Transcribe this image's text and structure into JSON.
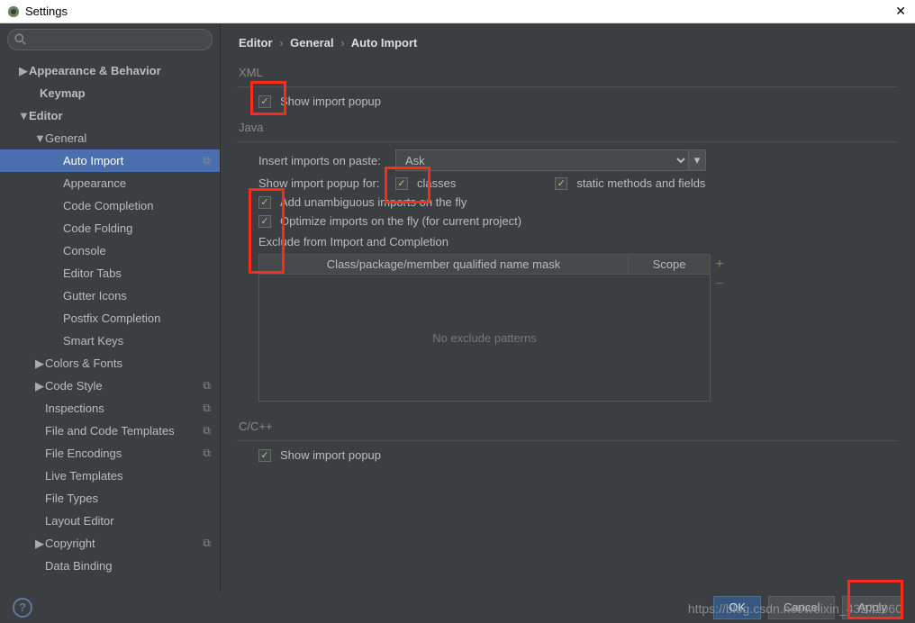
{
  "window": {
    "title": "Settings"
  },
  "search": {
    "placeholder": ""
  },
  "tree": [
    {
      "label": "Appearance & Behavior",
      "indent": 20,
      "arrow": "▶",
      "bold": true
    },
    {
      "label": "Keymap",
      "indent": 32,
      "arrow": "",
      "bold": true
    },
    {
      "label": "Editor",
      "indent": 20,
      "arrow": "▼",
      "bold": true
    },
    {
      "label": "General",
      "indent": 38,
      "arrow": "▼",
      "bold": false
    },
    {
      "label": "Auto Import",
      "indent": 58,
      "arrow": "",
      "bold": false,
      "selected": true,
      "copy": true
    },
    {
      "label": "Appearance",
      "indent": 58,
      "arrow": "",
      "bold": false
    },
    {
      "label": "Code Completion",
      "indent": 58,
      "arrow": "",
      "bold": false
    },
    {
      "label": "Code Folding",
      "indent": 58,
      "arrow": "",
      "bold": false
    },
    {
      "label": "Console",
      "indent": 58,
      "arrow": "",
      "bold": false
    },
    {
      "label": "Editor Tabs",
      "indent": 58,
      "arrow": "",
      "bold": false
    },
    {
      "label": "Gutter Icons",
      "indent": 58,
      "arrow": "",
      "bold": false
    },
    {
      "label": "Postfix Completion",
      "indent": 58,
      "arrow": "",
      "bold": false
    },
    {
      "label": "Smart Keys",
      "indent": 58,
      "arrow": "",
      "bold": false
    },
    {
      "label": "Colors & Fonts",
      "indent": 38,
      "arrow": "▶",
      "bold": false
    },
    {
      "label": "Code Style",
      "indent": 38,
      "arrow": "▶",
      "bold": false,
      "copy": true
    },
    {
      "label": "Inspections",
      "indent": 38,
      "arrow": "",
      "bold": false,
      "copy": true
    },
    {
      "label": "File and Code Templates",
      "indent": 38,
      "arrow": "",
      "bold": false,
      "copy": true
    },
    {
      "label": "File Encodings",
      "indent": 38,
      "arrow": "",
      "bold": false,
      "copy": true
    },
    {
      "label": "Live Templates",
      "indent": 38,
      "arrow": "",
      "bold": false
    },
    {
      "label": "File Types",
      "indent": 38,
      "arrow": "",
      "bold": false
    },
    {
      "label": "Layout Editor",
      "indent": 38,
      "arrow": "",
      "bold": false
    },
    {
      "label": "Copyright",
      "indent": 38,
      "arrow": "▶",
      "bold": false,
      "copy": true
    },
    {
      "label": "Data Binding",
      "indent": 38,
      "arrow": "",
      "bold": false
    }
  ],
  "breadcrumb": {
    "a": "Editor",
    "b": "General",
    "c": "Auto Import"
  },
  "xml": {
    "heading": "XML",
    "show_popup": "Show import popup"
  },
  "java": {
    "heading": "Java",
    "insert_label": "Insert imports on paste:",
    "insert_value": "Ask",
    "show_popup_for": "Show import popup for:",
    "opt_classes": "classes",
    "opt_static": "static methods and fields",
    "add_unambig": "Add unambiguous imports on the fly",
    "optimize": "Optimize imports on the fly (for current project)",
    "exclude_heading": "Exclude from Import and Completion",
    "col_mask": "Class/package/member qualified name mask",
    "col_scope": "Scope",
    "empty": "No exclude patterns"
  },
  "cpp": {
    "heading": "C/C++",
    "show_popup": "Show import popup"
  },
  "footer": {
    "ok": "OK",
    "cancel": "Cancel",
    "apply": "Apply"
  },
  "watermark": "https://blog.csdn.net/weixin_43271060"
}
